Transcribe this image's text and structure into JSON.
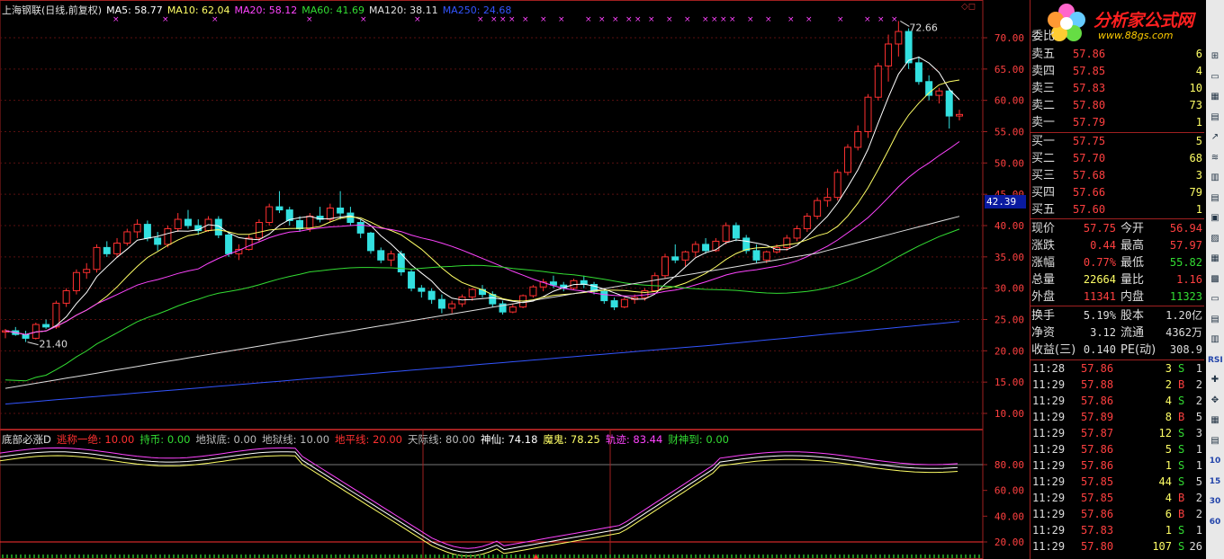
{
  "ma_legend": [
    {
      "label": "上海钢联(日线,前复权)",
      "color": "#e0e0e0"
    },
    {
      "label": "MA5: 58.77",
      "color": "#ffffff"
    },
    {
      "label": "MA10: 62.04",
      "color": "#ffff66"
    },
    {
      "label": "MA20: 58.12",
      "color": "#ff44ff"
    },
    {
      "label": "MA60: 41.69",
      "color": "#33dd33"
    },
    {
      "label": "MA120: 38.11",
      "color": "#e0e0e0"
    },
    {
      "label": "MA250: 24.68",
      "color": "#3355ff"
    }
  ],
  "indicator_legend": [
    {
      "label": "底部必涨D",
      "color": "#e0e0e0"
    },
    {
      "label": "逃称一绝: 10.00",
      "color": "#ff3030"
    },
    {
      "label": "持币: 0.00",
      "color": "#33dd33"
    },
    {
      "label": "地狱底: 0.00",
      "color": "#bbbbbb"
    },
    {
      "label": "地狱线: 10.00",
      "color": "#bbbbbb"
    },
    {
      "label": "地平线: 20.00",
      "color": "#ff3030"
    },
    {
      "label": "天际线: 80.00",
      "color": "#bbbbbb"
    },
    {
      "label": "神仙: 74.18",
      "color": "#ffffff"
    },
    {
      "label": "魔鬼: 78.25",
      "color": "#ffff66"
    },
    {
      "label": "轨迹: 83.44",
      "color": "#ff44ff"
    },
    {
      "label": "财神到: 0.00",
      "color": "#33dd33"
    }
  ],
  "price_axis": [
    "70.00",
    "65.00",
    "60.00",
    "55.00",
    "50.00",
    "45.00",
    "40.00",
    "35.00",
    "30.00",
    "25.00",
    "20.00",
    "15.00",
    "10.00"
  ],
  "indicator_axis": [
    "80.00",
    "60.00",
    "40.00",
    "20.00"
  ],
  "annotations": {
    "high": "72.66",
    "low": "21.40"
  },
  "current_price_tag": "42.39",
  "chart_data": {
    "type": "candlestick",
    "title": "上海钢联(日线,前复权)",
    "ylim": [
      8,
      76
    ],
    "y_ticks": [
      10,
      15,
      20,
      25,
      30,
      35,
      40,
      45,
      50,
      55,
      60,
      65,
      70
    ],
    "high_label": 72.66,
    "low_label": 21.4,
    "candles": [
      [
        23,
        23.5,
        22,
        23.2
      ],
      [
        23.2,
        23.8,
        22.4,
        22.6
      ],
      [
        22.6,
        23.2,
        21.4,
        22.0
      ],
      [
        22,
        24.5,
        21.8,
        24.2
      ],
      [
        24.2,
        25,
        23.5,
        23.8
      ],
      [
        23.8,
        28,
        23.5,
        27.6
      ],
      [
        27.6,
        30,
        27,
        29.6
      ],
      [
        29.6,
        33,
        29,
        32.5
      ],
      [
        32.5,
        34,
        31.5,
        33
      ],
      [
        33,
        37,
        32.5,
        36.5
      ],
      [
        36.5,
        37.5,
        35,
        35.5
      ],
      [
        35.5,
        38,
        35,
        37.2
      ],
      [
        37.2,
        39.5,
        36.8,
        39
      ],
      [
        39,
        41,
        38,
        40.2
      ],
      [
        40.2,
        40.8,
        37.5,
        38
      ],
      [
        38,
        39,
        36,
        37
      ],
      [
        37,
        40,
        36.5,
        39.5
      ],
      [
        39.5,
        42,
        39,
        41
      ],
      [
        41,
        42.5,
        39.5,
        40
      ],
      [
        40,
        41,
        38.5,
        39.2
      ],
      [
        39.2,
        41.5,
        39,
        41
      ],
      [
        41,
        41.5,
        38,
        38.5
      ],
      [
        38.5,
        39,
        35,
        35.5
      ],
      [
        35.5,
        37,
        34.5,
        36.2
      ],
      [
        36.2,
        38.5,
        36,
        38
      ],
      [
        38,
        41,
        37.5,
        40.5
      ],
      [
        40.5,
        43.5,
        40,
        43
      ],
      [
        43,
        45.5,
        42,
        42.5
      ],
      [
        42.5,
        43,
        40,
        40.8
      ],
      [
        40.8,
        41.5,
        39,
        39.5
      ],
      [
        39.5,
        42,
        39,
        41.5
      ],
      [
        41.5,
        43,
        40.5,
        41
      ],
      [
        41,
        43.5,
        40.5,
        42.8
      ],
      [
        42.8,
        45.5,
        41,
        42
      ],
      [
        42,
        43,
        40,
        40.5
      ],
      [
        40.5,
        41,
        38,
        38.8
      ],
      [
        38.8,
        39,
        35.5,
        36
      ],
      [
        36,
        36.5,
        34,
        34.5
      ],
      [
        34.5,
        36,
        33.5,
        35.5
      ],
      [
        35.5,
        36,
        32,
        32.6
      ],
      [
        32.6,
        33,
        29.5,
        30
      ],
      [
        30,
        30.5,
        28.5,
        29.5
      ],
      [
        29.5,
        30,
        27.5,
        28.2
      ],
      [
        28.2,
        29,
        26,
        26.8
      ],
      [
        26.8,
        28,
        26,
        27.5
      ],
      [
        27.5,
        29,
        27,
        28.6
      ],
      [
        28.6,
        30,
        28,
        29.8
      ],
      [
        29.8,
        30.5,
        28.5,
        29
      ],
      [
        29,
        29.5,
        27,
        27.5
      ],
      [
        27.5,
        28,
        25.8,
        26.2
      ],
      [
        26.2,
        27.5,
        26,
        27
      ],
      [
        27,
        29,
        26.8,
        28.8
      ],
      [
        28.8,
        30.5,
        28.5,
        30.2
      ],
      [
        30.2,
        31.5,
        29.5,
        31
      ],
      [
        31,
        32,
        30,
        30.5
      ],
      [
        30.5,
        31,
        29.5,
        30
      ],
      [
        30,
        31.5,
        29.8,
        31.2
      ],
      [
        31.2,
        32,
        30,
        30.6
      ],
      [
        30.6,
        31,
        29,
        29.5
      ],
      [
        29.5,
        30,
        27.5,
        28
      ],
      [
        28,
        28.5,
        26.5,
        27
      ],
      [
        27,
        28.5,
        26.8,
        28.2
      ],
      [
        28.2,
        29,
        27.5,
        28.5
      ],
      [
        28.5,
        30,
        28,
        29.6
      ],
      [
        29.6,
        32.5,
        29.5,
        32
      ],
      [
        32,
        35.5,
        31.5,
        35
      ],
      [
        35,
        37,
        34,
        34.5
      ],
      [
        34.5,
        36,
        33.5,
        35.8
      ],
      [
        35.8,
        37.5,
        35,
        37
      ],
      [
        37,
        38,
        35.5,
        36
      ],
      [
        36,
        38,
        35.8,
        37.5
      ],
      [
        37.5,
        40.5,
        37,
        40
      ],
      [
        40,
        40.5,
        37.5,
        38
      ],
      [
        38,
        38.5,
        35.5,
        36
      ],
      [
        36,
        37,
        34,
        34.5
      ],
      [
        34.5,
        36,
        34,
        35.8
      ],
      [
        35.8,
        37,
        35.5,
        36.5
      ],
      [
        36.5,
        38.5,
        36,
        38
      ],
      [
        38,
        40,
        37.5,
        39.5
      ],
      [
        39.5,
        42,
        39,
        41.5
      ],
      [
        41.5,
        44.5,
        41,
        44
      ],
      [
        44,
        46,
        43,
        44.5
      ],
      [
        44.5,
        49,
        44,
        48.5
      ],
      [
        48.5,
        53,
        48,
        52.5
      ],
      [
        52.5,
        56,
        52,
        55
      ],
      [
        55,
        61,
        54,
        60.5
      ],
      [
        60.5,
        66,
        60,
        65.5
      ],
      [
        65.5,
        70.5,
        63,
        69
      ],
      [
        69,
        72.66,
        67,
        71
      ],
      [
        71,
        71.5,
        65,
        66
      ],
      [
        66,
        67,
        62.5,
        63
      ],
      [
        63,
        64,
        60,
        60.8
      ],
      [
        60.8,
        62,
        59.5,
        61.5
      ],
      [
        61.5,
        62,
        55.5,
        57.5
      ],
      [
        57.5,
        58.5,
        56.8,
        57.75
      ]
    ]
  },
  "quote": {
    "weibi_label": "委比",
    "sell": [
      {
        "label": "卖五",
        "price": "57.86",
        "vol": "6"
      },
      {
        "label": "卖四",
        "price": "57.85",
        "vol": "4"
      },
      {
        "label": "卖三",
        "price": "57.83",
        "vol": "10"
      },
      {
        "label": "卖二",
        "price": "57.80",
        "vol": "73"
      },
      {
        "label": "卖一",
        "price": "57.79",
        "vol": "1"
      }
    ],
    "buy": [
      {
        "label": "买一",
        "price": "57.75",
        "vol": "5"
      },
      {
        "label": "买二",
        "price": "57.70",
        "vol": "68"
      },
      {
        "label": "买三",
        "price": "57.68",
        "vol": "3"
      },
      {
        "label": "买四",
        "price": "57.66",
        "vol": "79"
      },
      {
        "label": "买五",
        "price": "57.60",
        "vol": "1"
      }
    ],
    "stats": [
      {
        "k1": "现价",
        "v1": "57.75",
        "c1": "#ff4040",
        "k2": "今开",
        "v2": "56.94",
        "c2": "#ff4040"
      },
      {
        "k1": "涨跌",
        "v1": "0.44",
        "c1": "#ff4040",
        "k2": "最高",
        "v2": "57.97",
        "c2": "#ff4040"
      },
      {
        "k1": "涨幅",
        "v1": "0.77%",
        "c1": "#ff4040",
        "k2": "最低",
        "v2": "55.82",
        "c2": "#33dd33"
      },
      {
        "k1": "总量",
        "v1": "22664",
        "c1": "#ffff66",
        "k2": "量比",
        "v2": "1.16",
        "c2": "#ff4040"
      },
      {
        "k1": "外盘",
        "v1": "11341",
        "c1": "#ff4040",
        "k2": "内盘",
        "v2": "11323",
        "c2": "#33dd33"
      }
    ],
    "fund": [
      {
        "k1": "换手",
        "v1": "5.19%",
        "k2": "股本",
        "v2": "1.20亿"
      },
      {
        "k1": "净资",
        "v1": "3.12",
        "k2": "流通",
        "v2": "4362万"
      },
      {
        "k1": "收益(三)",
        "v1": "0.140",
        "k2": "PE(动)",
        "v2": "308.9"
      }
    ],
    "ticks": [
      {
        "t": "11:28",
        "p": "57.86",
        "v": "3",
        "s": "S",
        "n": "1"
      },
      {
        "t": "11:29",
        "p": "57.88",
        "v": "2",
        "s": "B",
        "n": "2"
      },
      {
        "t": "11:29",
        "p": "57.86",
        "v": "4",
        "s": "S",
        "n": "2"
      },
      {
        "t": "11:29",
        "p": "57.89",
        "v": "8",
        "s": "B",
        "n": "5"
      },
      {
        "t": "11:29",
        "p": "57.87",
        "v": "12",
        "s": "S",
        "n": "3"
      },
      {
        "t": "11:29",
        "p": "57.86",
        "v": "5",
        "s": "S",
        "n": "1"
      },
      {
        "t": "11:29",
        "p": "57.86",
        "v": "1",
        "s": "S",
        "n": "1"
      },
      {
        "t": "11:29",
        "p": "57.85",
        "v": "44",
        "s": "S",
        "n": "5"
      },
      {
        "t": "11:29",
        "p": "57.85",
        "v": "4",
        "s": "B",
        "n": "2"
      },
      {
        "t": "11:29",
        "p": "57.86",
        "v": "6",
        "s": "B",
        "n": "2"
      },
      {
        "t": "11:29",
        "p": "57.83",
        "v": "1",
        "s": "S",
        "n": "1"
      },
      {
        "t": "11:29",
        "p": "57.80",
        "v": "107",
        "s": "S",
        "n": "26"
      }
    ]
  },
  "logo": {
    "text": "分析家公式网",
    "url": "www.88gs.com"
  },
  "toolbar": [
    "⊞",
    "▭",
    "▦",
    "▤",
    "↗",
    "≋",
    "▥",
    "▤",
    "▣",
    "▨",
    "▦",
    "▩",
    "▭",
    "▤",
    "▥",
    "RSI",
    "✚",
    "✥",
    "▦",
    "▤",
    "10",
    "15",
    "30",
    "60"
  ]
}
